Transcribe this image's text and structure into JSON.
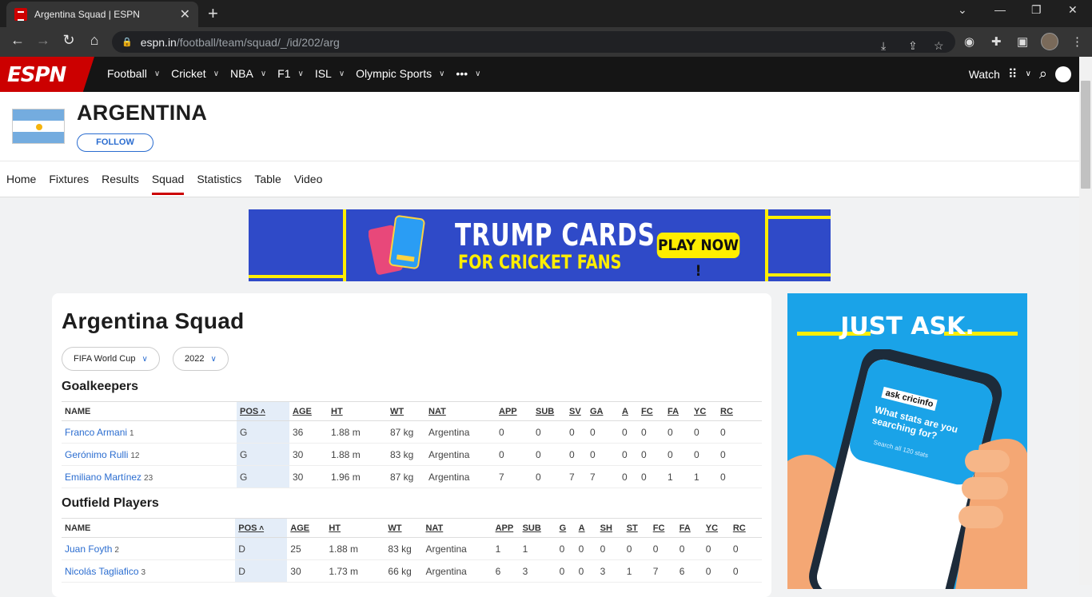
{
  "browser": {
    "tab_title": "Argentina Squad | ESPN",
    "url_domain": "espn.in",
    "url_path": "/football/team/squad/_/id/202/arg"
  },
  "espn_nav": {
    "logo": "ESPN",
    "items": [
      "Football",
      "Cricket",
      "NBA",
      "F1",
      "ISL",
      "Olympic Sports",
      "•••"
    ],
    "watch": "Watch"
  },
  "team": {
    "name": "ARGENTINA",
    "follow": "FOLLOW",
    "subnav": [
      "Home",
      "Fixtures",
      "Results",
      "Squad",
      "Statistics",
      "Table",
      "Video"
    ],
    "active_subnav": "Squad"
  },
  "ad_top": {
    "line1": "TRUMP CARDS",
    "line2": "FOR CRICKET FANS",
    "cta": "PLAY NOW !"
  },
  "squad": {
    "title": "Argentina Squad",
    "competition": "FIFA World Cup",
    "season": "2022",
    "goalkeepers": {
      "heading": "Goalkeepers",
      "columns": [
        "NAME",
        "POS",
        "AGE",
        "HT",
        "WT",
        "NAT",
        "APP",
        "SUB",
        "SV",
        "GA",
        "A",
        "FC",
        "FA",
        "YC",
        "RC"
      ],
      "rows": [
        {
          "name": "Franco Armani",
          "num": "1",
          "pos": "G",
          "age": "36",
          "ht": "1.88 m",
          "wt": "87 kg",
          "nat": "Argentina",
          "app": "0",
          "sub": "0",
          "sv": "0",
          "ga": "0",
          "a": "0",
          "fc": "0",
          "fa": "0",
          "yc": "0",
          "rc": "0"
        },
        {
          "name": "Gerónimo Rulli",
          "num": "12",
          "pos": "G",
          "age": "30",
          "ht": "1.88 m",
          "wt": "83 kg",
          "nat": "Argentina",
          "app": "0",
          "sub": "0",
          "sv": "0",
          "ga": "0",
          "a": "0",
          "fc": "0",
          "fa": "0",
          "yc": "0",
          "rc": "0"
        },
        {
          "name": "Emiliano Martínez",
          "num": "23",
          "pos": "G",
          "age": "30",
          "ht": "1.96 m",
          "wt": "87 kg",
          "nat": "Argentina",
          "app": "7",
          "sub": "0",
          "sv": "7",
          "ga": "7",
          "a": "0",
          "fc": "0",
          "fa": "1",
          "yc": "1",
          "rc": "0"
        }
      ]
    },
    "outfield": {
      "heading": "Outfield Players",
      "columns": [
        "NAME",
        "POS",
        "AGE",
        "HT",
        "WT",
        "NAT",
        "APP",
        "SUB",
        "G",
        "A",
        "SH",
        "ST",
        "FC",
        "FA",
        "YC",
        "RC"
      ],
      "rows": [
        {
          "name": "Juan Foyth",
          "num": "2",
          "pos": "D",
          "age": "25",
          "ht": "1.88 m",
          "wt": "83 kg",
          "nat": "Argentina",
          "app": "1",
          "sub": "1",
          "g": "0",
          "a": "0",
          "sh": "0",
          "st": "0",
          "fc": "0",
          "fa": "0",
          "yc": "0",
          "rc": "0"
        },
        {
          "name": "Nicolás Tagliafico",
          "num": "3",
          "pos": "D",
          "age": "30",
          "ht": "1.73 m",
          "wt": "66 kg",
          "nat": "Argentina",
          "app": "6",
          "sub": "3",
          "g": "0",
          "a": "0",
          "sh": "3",
          "st": "1",
          "fc": "7",
          "fa": "6",
          "yc": "0",
          "rc": "0"
        }
      ]
    }
  },
  "side_ad": {
    "headline": "JUST ASK.",
    "brand": "ask cricinfo",
    "prompt": "What stats are you searching for?",
    "search_placeholder": "Search all 120 stats"
  }
}
